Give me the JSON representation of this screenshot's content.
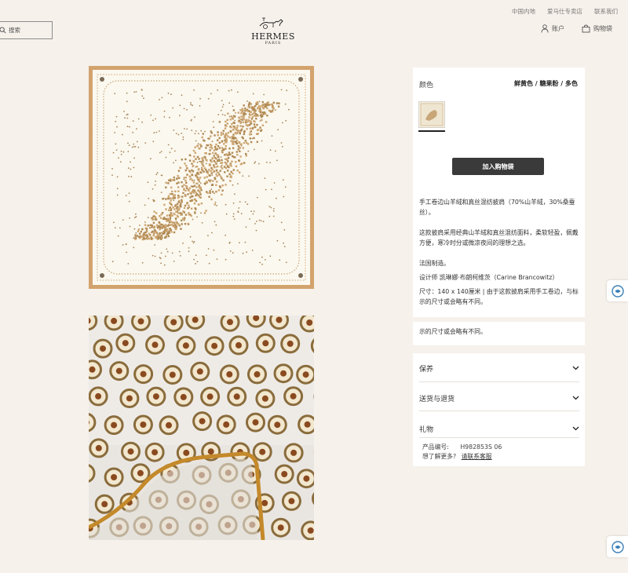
{
  "header": {
    "top_links": [
      "中国内地",
      "爱马仕专卖店",
      "联系我们"
    ],
    "search_placeholder": "搜索",
    "logo_word": "HERMES",
    "logo_sub": "PARIS",
    "account_label": "账户",
    "bag_label": "购物袋"
  },
  "product": {
    "color_label": "颜色",
    "color_value": "鲜黄色 / 糖果粉 / 多色",
    "add_to_bag": "加入购物袋",
    "description_title": "手工卷边山羊绒和真丝混纺披肩（70%山羊绒，30%桑蚕丝）。",
    "description_body": "这款披肩采用经典山羊绒和真丝混纺面料，柔软轻盈，佩戴方便，寒冷时分或微凉夜间的理想之选。",
    "made_in": "法国制造。",
    "designer": "设计师 凯琳娜·布朗柯维茨（Carine Brancowitz）",
    "size_note": "尺寸：140 x 140厘米 | 由于这款披肩采用手工卷边，与标示的尺寸或会略有不同。",
    "size_note_repeat": "示的尺寸或会略有不同。"
  },
  "accordion": [
    "保养",
    "送货与退货",
    "礼物"
  ],
  "product_code_label": "产品编号:",
  "product_code_value": "H982853S 06",
  "help_question": "想了解更多?",
  "help_link": "请联系客服"
}
